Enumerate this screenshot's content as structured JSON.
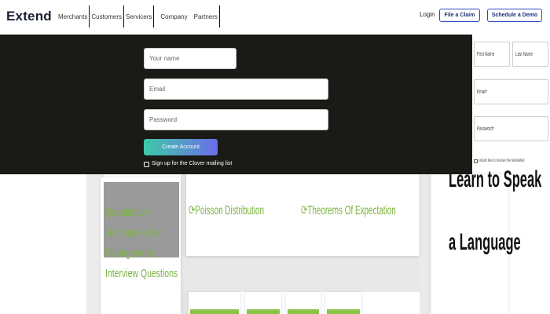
{
  "nav": {
    "logo": "Extend",
    "links": [
      "Merchants",
      "Customers",
      "Servicers",
      "Company",
      "Partners"
    ],
    "login": "Login",
    "file_claim": "File a Claim",
    "schedule_demo": "Schedule a Demo"
  },
  "signup": {
    "name_placeholder": "Your name",
    "email_placeholder": "Email",
    "password_placeholder": "Password",
    "create_button": "Create Account",
    "mailing_list_label": "Sign up for the Clover mailing list",
    "button_gradient": [
      "#3ec9a7",
      "#6a6ee8"
    ],
    "overlay_color": "#1b1a16"
  },
  "side_form": {
    "first_name": "First Name",
    "last_name": "Last Name",
    "email": "Email*",
    "password": "Password*",
    "checkbox_label": "I would like to receive the newsletter"
  },
  "background": {
    "left_card_title": "Quantitative Techniques For Management Interview Questions",
    "topics": [
      "Poisson Distribution",
      "Theorems Of Expectation"
    ],
    "ad_lines": [
      "Learn to Speak",
      "a Language"
    ],
    "accent_color": "#7cb342"
  }
}
